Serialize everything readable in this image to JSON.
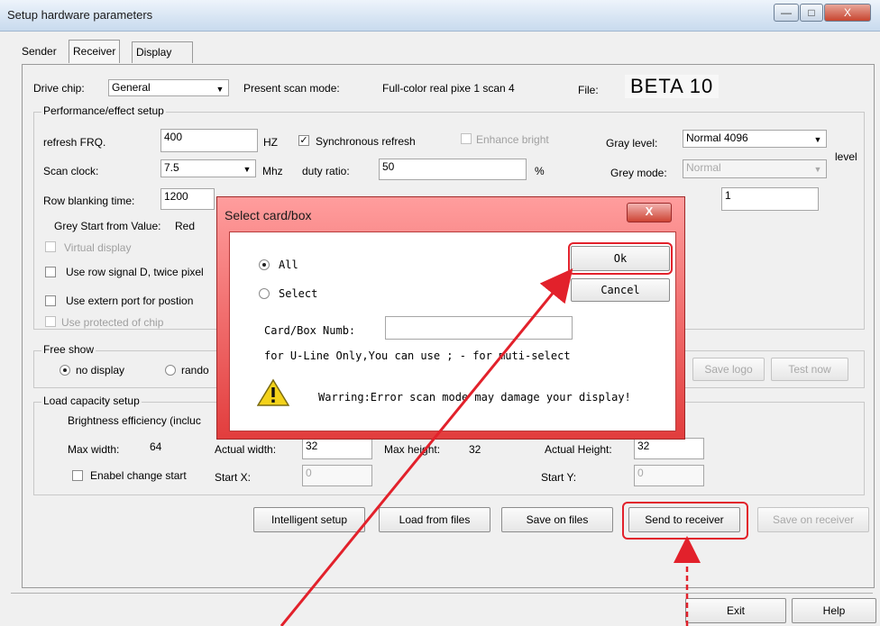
{
  "window": {
    "title": "Setup hardware parameters",
    "minimize": "—",
    "maximize": "□",
    "close": "X"
  },
  "tabs": [
    "Sender",
    "Receiver",
    "Display connection"
  ],
  "top": {
    "drive_chip_label": "Drive chip:",
    "drive_chip_value": "General",
    "present_scan_label": "Present scan mode:",
    "present_scan_value": "Full-color real pixe 1 scan 4",
    "file_label": "File:",
    "file_value": "BETA 10"
  },
  "perf": {
    "legend": "Performance/effect setup",
    "refresh_label": "refresh FRQ.",
    "refresh_value": "400",
    "hz": "HZ",
    "sync_label": "Synchronous refresh",
    "enhance_label": "Enhance bright",
    "gray_level_label": "Gray level:",
    "gray_level_value": "Normal 4096",
    "level_suffix": "level",
    "scan_clock_label": "Scan clock:",
    "scan_clock_value": "7.5",
    "mhz": "Mhz",
    "duty_label": "duty ratio:",
    "duty_value": "50",
    "percent": "%",
    "grey_mode_label": "Grey mode:",
    "grey_mode_value": "Normal",
    "row_blank_label": "Row blanking time:",
    "row_blank_value": "1200",
    "right_field_value": "1",
    "grey_start_label": "Grey Start from Value:",
    "grey_start_value": "Red",
    "virtual_display": "Virtual display",
    "use_row_signal": "Use row signal D, twice pixel",
    "use_extern_port": "Use extern port for postion",
    "use_protected": "Use protected of chip"
  },
  "free_show": {
    "legend": "Free show",
    "no_display": "no display",
    "random": "rando",
    "save_logo": "Save logo",
    "test_now": "Test now"
  },
  "load": {
    "legend": "Load capacity setup",
    "brightness": "Brightness efficiency (incluc",
    "max_width_label": "Max width:",
    "max_width_value": "64",
    "actual_width_label": "Actual width:",
    "actual_width_value": "32",
    "max_height_label": "Max height:",
    "max_height_value": "32",
    "actual_height_label": "Actual Height:",
    "actual_height_value": "32",
    "enable_change_start": "Enabel change start",
    "start_x_label": "Start X:",
    "start_x_value": "0",
    "start_y_label": "Start Y:",
    "start_y_value": "0"
  },
  "buttons": {
    "intelligent": "Intelligent setup",
    "load_files": "Load from files",
    "save_files": "Save on files",
    "send_receiver": "Send to receiver",
    "save_receiver": "Save on receiver",
    "exit": "Exit",
    "help": "Help"
  },
  "dialog": {
    "title": "Select card/box",
    "close": "X",
    "all": "All",
    "select": "Select",
    "ok": "Ok",
    "cancel": "Cancel",
    "card_label": "Card/Box Numb:",
    "card_value": "",
    "note": "for U-Line Only,You can use ; - for muti-select",
    "warning": "Warring:Error scan mode may damage your display!"
  },
  "colors": {
    "annotation_red": "#e2212b",
    "dialog_frame": "#e54a4a"
  },
  "icons": {
    "warning": "warning-icon",
    "dropdown": "chevron-down-icon"
  }
}
